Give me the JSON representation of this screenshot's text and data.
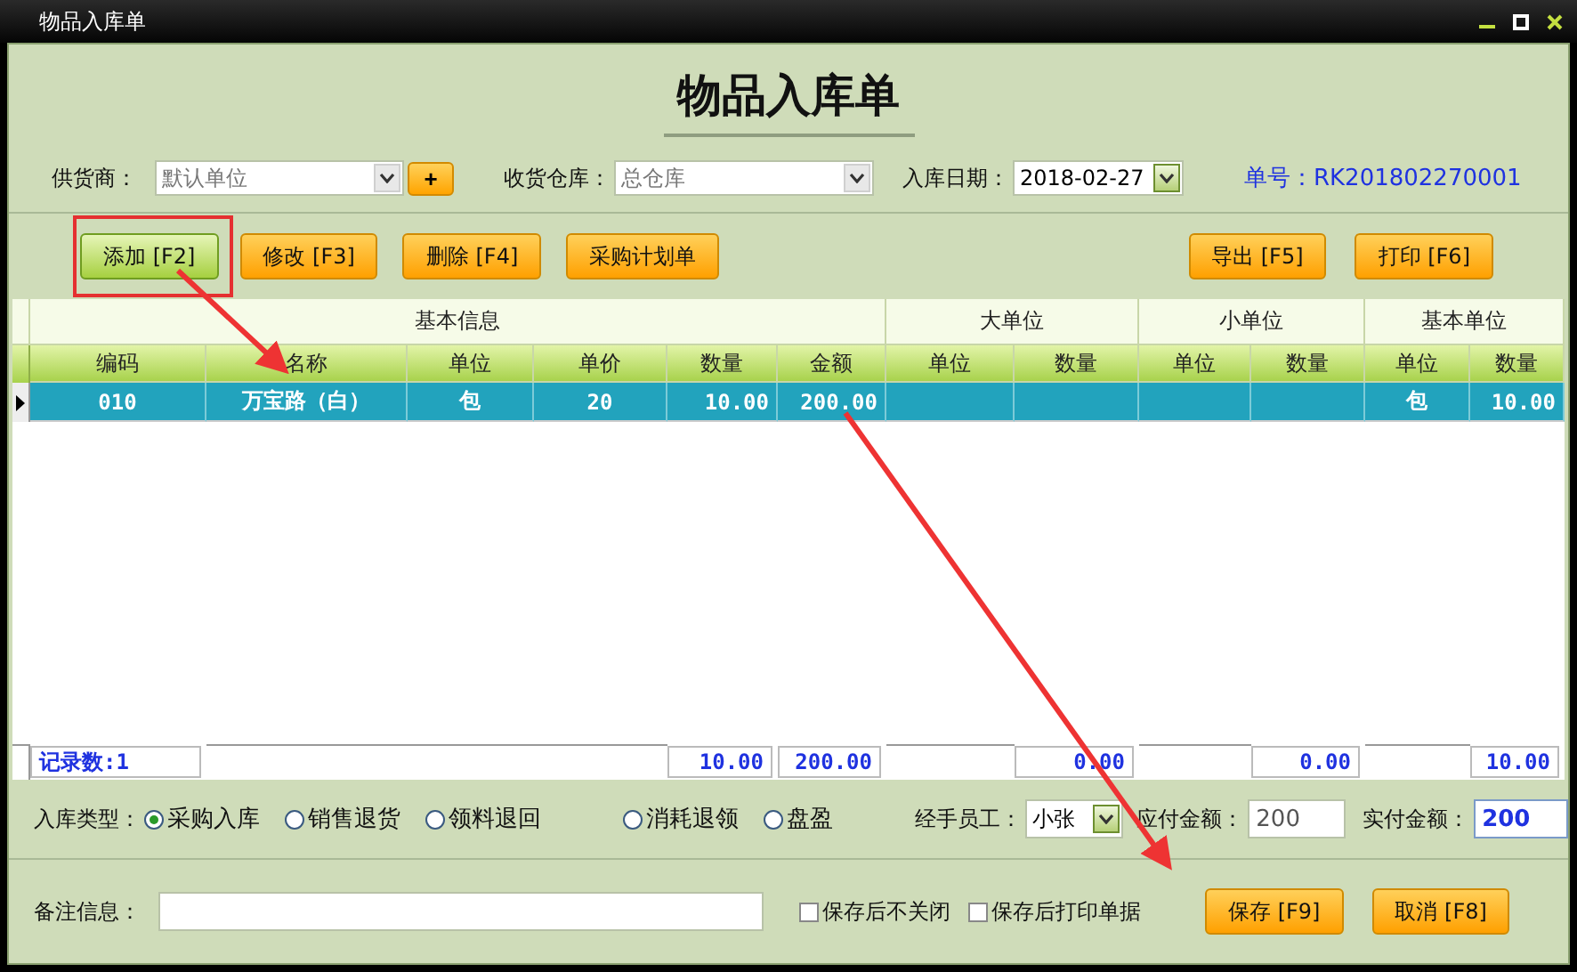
{
  "window": {
    "title": "物品入库单"
  },
  "heading": "物品入库单",
  "form": {
    "supplier": {
      "label": "供货商：",
      "value": "默认单位",
      "disabled": true
    },
    "add_button": "+",
    "warehouse": {
      "label": "收货仓库：",
      "value": "总仓库",
      "disabled": true
    },
    "date": {
      "label": "入库日期：",
      "value": "2018-02-27"
    },
    "order_no": {
      "label": "单号：",
      "value": "RK201802270001"
    }
  },
  "toolbar": {
    "left": [
      {
        "label": "添加 [F2]",
        "focused": true
      },
      {
        "label": "修改 [F3]",
        "focused": false
      },
      {
        "label": "删除 [F4]",
        "focused": false
      },
      {
        "label": "采购计划单",
        "focused": false
      }
    ],
    "right": [
      {
        "label": "导出 [F5]",
        "focused": false
      },
      {
        "label": "打印 [F6]",
        "focused": false
      }
    ]
  },
  "grid": {
    "groups": [
      {
        "label": "基本信息",
        "columns": [
          "编码",
          "名称",
          "单位",
          "单价",
          "数量",
          "金额"
        ]
      },
      {
        "label": "大单位",
        "columns": [
          "单位",
          "数量"
        ]
      },
      {
        "label": "小单位",
        "columns": [
          "单位",
          "数量"
        ]
      },
      {
        "label": "基本单位",
        "columns": [
          "单位",
          "数量"
        ]
      }
    ],
    "rows": [
      {
        "selected": true,
        "cells": [
          "010",
          "万宝路（白）",
          "包",
          "20",
          "10.00",
          "200.00",
          "",
          "",
          "",
          "",
          "包",
          "10.00"
        ]
      }
    ],
    "footer": [
      {
        "kind": "label",
        "text": "记录数:1"
      },
      {
        "kind": "empty"
      },
      {
        "kind": "empty"
      },
      {
        "kind": "empty"
      },
      {
        "kind": "total",
        "text": "10.00"
      },
      {
        "kind": "total",
        "text": "200.00"
      },
      {
        "kind": "empty"
      },
      {
        "kind": "total",
        "text": "0.00"
      },
      {
        "kind": "empty"
      },
      {
        "kind": "total",
        "text": "0.00"
      },
      {
        "kind": "empty"
      },
      {
        "kind": "total",
        "text": "10.00"
      }
    ]
  },
  "type_row": {
    "label": "入库类型：",
    "options": [
      {
        "label": "采购入库",
        "selected": true
      },
      {
        "label": "销售退货",
        "selected": false
      },
      {
        "label": "领料退回",
        "selected": false
      },
      {
        "label": "消耗退领",
        "selected": false
      },
      {
        "label": "盘盈",
        "selected": false
      }
    ],
    "staff": {
      "label": "经手员工：",
      "value": "小张"
    },
    "payable": {
      "label": "应付金额：",
      "value": "200"
    },
    "paid": {
      "label": "实付金额：",
      "value": "200"
    }
  },
  "remark_row": {
    "label": "备注信息：",
    "options": [
      {
        "label": "保存后不关闭",
        "checked": false
      },
      {
        "label": "保存后打印单据",
        "checked": false
      }
    ],
    "buttons": [
      {
        "label": "保存 [F9]",
        "focused": false
      },
      {
        "label": "取消 [F8]",
        "focused": false
      }
    ]
  }
}
